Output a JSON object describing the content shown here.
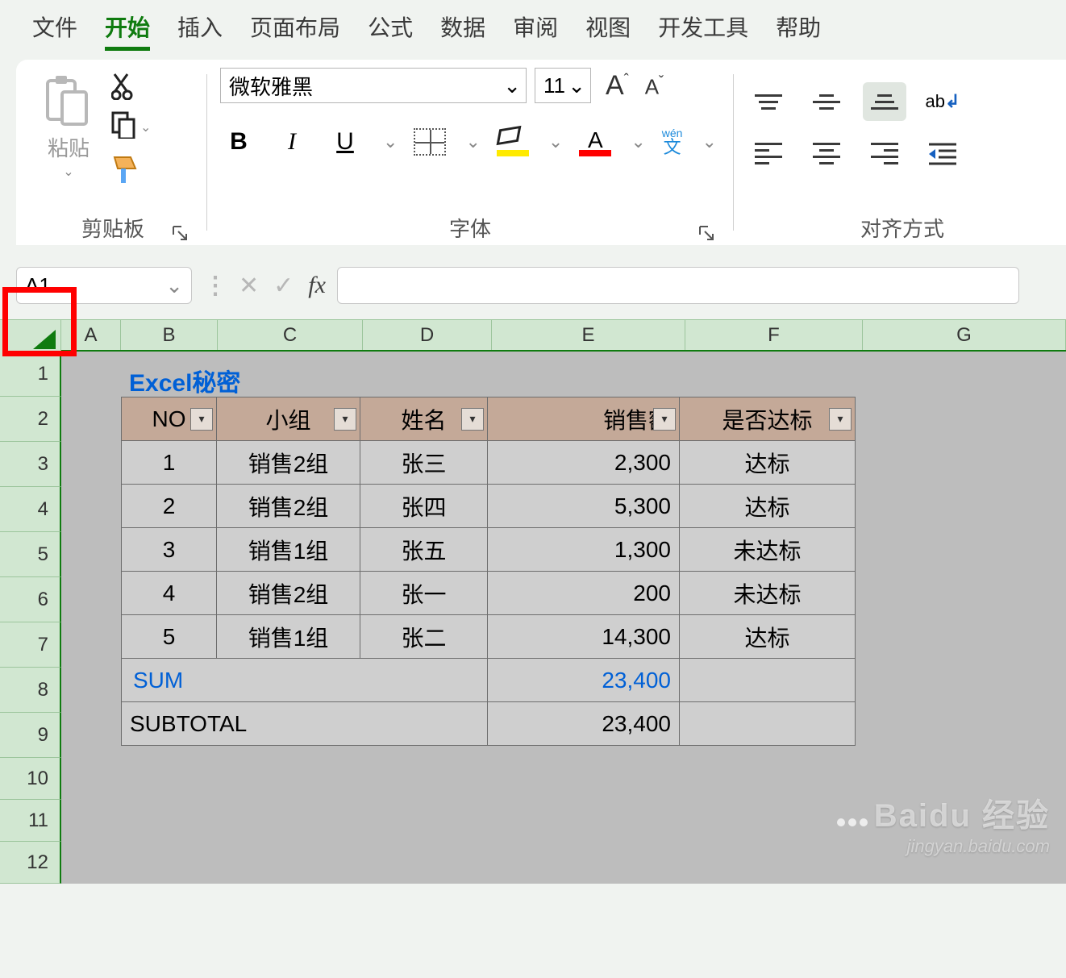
{
  "tabs": {
    "file": "文件",
    "home": "开始",
    "insert": "插入",
    "layout": "页面布局",
    "formulas": "公式",
    "data": "数据",
    "review": "审阅",
    "view": "视图",
    "developer": "开发工具",
    "help": "帮助"
  },
  "ribbon": {
    "clipboard": {
      "paste": "粘贴",
      "label": "剪贴板"
    },
    "font": {
      "name": "微软雅黑",
      "size": "11",
      "grow": "A",
      "shrink": "A",
      "bold": "B",
      "italic": "I",
      "underline": "U",
      "wen_pinyin": "wén",
      "wen_char": "文",
      "label": "字体"
    },
    "align": {
      "label": "对齐方式"
    }
  },
  "namebox": "A1",
  "fx_label": "fx",
  "columns": {
    "A": "A",
    "B": "B",
    "C": "C",
    "D": "D",
    "E": "E",
    "F": "F",
    "G": "G"
  },
  "rows": [
    "1",
    "2",
    "3",
    "4",
    "5",
    "6",
    "7",
    "8",
    "9",
    "10",
    "11",
    "12"
  ],
  "title": "Excel秘密",
  "headers": {
    "no": "NO",
    "group": "小组",
    "name": "姓名",
    "sales": "销售额",
    "pass": "是否达标"
  },
  "data": [
    {
      "no": "1",
      "group": "销售2组",
      "name": "张三",
      "sales": "2,300",
      "pass": "达标"
    },
    {
      "no": "2",
      "group": "销售2组",
      "name": "张四",
      "sales": "5,300",
      "pass": "达标"
    },
    {
      "no": "3",
      "group": "销售1组",
      "name": "张五",
      "sales": "1,300",
      "pass": "未达标"
    },
    {
      "no": "4",
      "group": "销售2组",
      "name": "张一",
      "sales": "200",
      "pass": "未达标"
    },
    {
      "no": "5",
      "group": "销售1组",
      "name": "张二",
      "sales": "14,300",
      "pass": "达标"
    }
  ],
  "summary": {
    "sum_label": "SUM",
    "sum_value": "23,400",
    "subtotal_label": "SUBTOTAL",
    "subtotal_value": "23,400"
  },
  "watermark": {
    "brand": "Baidu 经验",
    "url": "jingyan.baidu.com"
  }
}
